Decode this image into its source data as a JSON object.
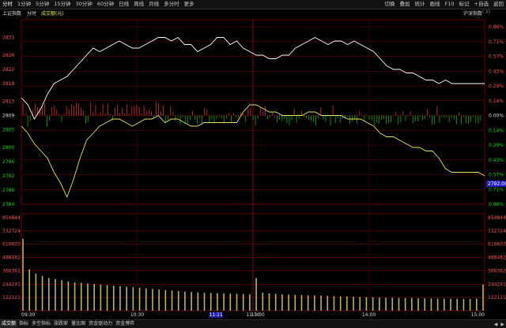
{
  "toolbar": {
    "tabs": [
      "分时",
      "1分钟",
      "5分钟",
      "15分钟",
      "30分钟",
      "60分钟",
      "日线",
      "周线",
      "月线",
      "多分时",
      "更多"
    ],
    "active_tab": 0,
    "right_tools": [
      "切换",
      "叠加",
      "统计",
      "画线",
      "F10",
      "标记",
      "+自选",
      "返回"
    ]
  },
  "chart_header": {
    "index_name": "上证指数",
    "chart_mode": "分时",
    "volume_tag": "成交额(元)",
    "compare_name": "沪深指数",
    "compare_suffix": "(.II)"
  },
  "price_axis": {
    "left": [
      "2831",
      "2826",
      "2822",
      "2818",
      "2813",
      "2809",
      "2805",
      "2800",
      "2796",
      "2792",
      "2788",
      "2784"
    ],
    "right": [
      "0.86%",
      "0.71%",
      "0.57%",
      "0.43%",
      "0.29%",
      "0.14%",
      "0.00%",
      "0.14%",
      "0.29%",
      "0.43%",
      "0.57%",
      "0.71%",
      "0.86%"
    ],
    "current_price_box": "2792.00"
  },
  "volume_axis": {
    "left": [
      "854844",
      "732724",
      "610603",
      "488482",
      "366362",
      "244241",
      "122121"
    ],
    "right": [
      "854844",
      "732724",
      "610603",
      "488482",
      "366362",
      "244241",
      "122121"
    ]
  },
  "time_axis": {
    "labels": [
      "09:30",
      "10:30",
      "11:30",
      "13:00",
      "14:00",
      "15:00"
    ],
    "cursor_label": "11:11"
  },
  "bottom_tabs": {
    "items": [
      "成交额",
      "指标",
      "多空指标",
      "涨跌家",
      "量比图",
      "资金驱动力",
      "资金博弈"
    ],
    "active": 0
  },
  "colors": {
    "price_line": "#ffffff",
    "avg_line": "#e6e65a",
    "up": "#ff3232",
    "down": "#00cc00",
    "grid": "#7a0000",
    "volume": "#b8b84c",
    "axis_up": "#ff5050",
    "axis_down": "#00d800"
  },
  "chart_data": {
    "type": "line",
    "xlabel": "",
    "ylabel": "",
    "prev_close": 2809,
    "ylim": [
      2784,
      2834
    ],
    "series": [
      {
        "values": [
          2814,
          2812,
          2808,
          2811,
          2815,
          2818,
          2819,
          2820,
          2822,
          2824,
          2826,
          2828,
          2827,
          2828,
          2829,
          2830,
          2829,
          2828,
          2828,
          2829,
          2830,
          2831,
          2831,
          2830,
          2831,
          2829,
          2829,
          2827,
          2828,
          2829,
          2831,
          2831,
          2829,
          2830,
          2828,
          2827,
          2826,
          2826,
          2825,
          2825,
          2826,
          2826,
          2828,
          2829,
          2830,
          2831,
          2830,
          2829,
          2830,
          2830,
          2829,
          2830,
          2829,
          2828,
          2827,
          2825,
          2823,
          2822,
          2822,
          2821,
          2821,
          2820,
          2819,
          2819,
          2818,
          2819,
          2818,
          2818,
          2818,
          2818,
          2818,
          2818
        ]
      },
      {
        "values": [
          2806,
          2804,
          2801,
          2799,
          2797,
          2793,
          2790,
          2786,
          2791,
          2797,
          2802,
          2804,
          2806,
          2807,
          2808,
          2808,
          2807,
          2806,
          2807,
          2808,
          2808,
          2809,
          2807,
          2808,
          2808,
          2807,
          2806,
          2806,
          2807,
          2807,
          2807,
          2807,
          2807,
          2807,
          2810,
          2812,
          2812,
          2811,
          2810,
          2810,
          2809,
          2809,
          2809,
          2809,
          2810,
          2810,
          2809,
          2809,
          2809,
          2809,
          2808,
          2808,
          2808,
          2807,
          2806,
          2804,
          2803,
          2803,
          2802,
          2801,
          2800,
          2800,
          2799,
          2799,
          2797,
          2794,
          2793,
          2793,
          2793,
          2793,
          2793,
          2792
        ]
      }
    ],
    "volume": [
      660000,
      380000,
      340000,
      320000,
      300000,
      290000,
      280000,
      270000,
      260000,
      255000,
      250000,
      245000,
      240000,
      235000,
      230000,
      225000,
      220000,
      215000,
      210000,
      205000,
      200000,
      195000,
      190000,
      185000,
      180000,
      176000,
      172000,
      168000,
      165000,
      162000,
      160000,
      158000,
      156000,
      154000,
      152000,
      150000,
      300000,
      165000,
      160000,
      155000,
      150000,
      148000,
      146000,
      144000,
      142000,
      140000,
      138000,
      136000,
      134000,
      132000,
      130000,
      128000,
      126000,
      124000,
      122000,
      120000,
      119000,
      118000,
      117000,
      116000,
      115000,
      114000,
      113000,
      112000,
      111000,
      110000,
      109000,
      108000,
      107000,
      108000,
      110000,
      240000
    ],
    "volume_ylim": [
      0,
      854844
    ]
  }
}
